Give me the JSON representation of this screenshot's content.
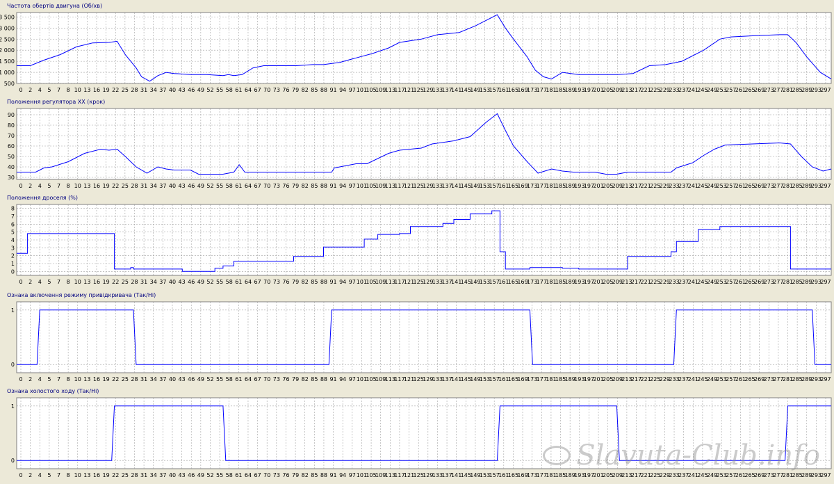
{
  "colors": {
    "background": "#ece9d8",
    "plot_area": "#ffffff",
    "line": "#0000ff",
    "grid": "#a0a0a0",
    "title": "#000080"
  },
  "x_tick_labels": [
    "0",
    "2",
    "4",
    "5",
    "7",
    "8",
    "10",
    "13",
    "16",
    "19",
    "22",
    "25",
    "28",
    "31",
    "34",
    "37",
    "40",
    "43",
    "46",
    "49",
    "52",
    "55",
    "58",
    "61",
    "64",
    "67",
    "70",
    "73",
    "76",
    "79",
    "82",
    "85",
    "88",
    "91",
    "94",
    "97",
    "101",
    "105",
    "109",
    "113",
    "117",
    "121",
    "125",
    "129",
    "133",
    "137",
    "141",
    "145",
    "149",
    "153",
    "157",
    "161",
    "165",
    "169",
    "173",
    "177",
    "181",
    "185",
    "189",
    "193",
    "197",
    "201",
    "205",
    "209",
    "213",
    "217",
    "221",
    "225",
    "229",
    "233",
    "237",
    "241",
    "245",
    "249",
    "253",
    "257",
    "261",
    "265",
    "269",
    "273",
    "277",
    "281",
    "285",
    "289",
    "293",
    "297"
  ],
  "watermark": "Slavuta-Club.info",
  "chart_data": [
    {
      "type": "line",
      "title": "Частота обертів двигуна (Об/хв)",
      "ylim": [
        500,
        3700
      ],
      "yticks": [
        500,
        1000,
        1500,
        2000,
        2500,
        3000,
        3500
      ],
      "ytick_labels": [
        "500",
        "1 000",
        "1 500",
        "2 000",
        "2 500",
        "3 000",
        "3 500"
      ],
      "step": false,
      "points": [
        [
          0,
          1300
        ],
        [
          5,
          1300
        ],
        [
          10,
          1550
        ],
        [
          16,
          1800
        ],
        [
          22,
          2150
        ],
        [
          28,
          2330
        ],
        [
          34,
          2350
        ],
        [
          37,
          2400
        ],
        [
          40,
          1800
        ],
        [
          44,
          1200
        ],
        [
          46,
          800
        ],
        [
          49,
          600
        ],
        [
          52,
          850
        ],
        [
          55,
          1000
        ],
        [
          58,
          950
        ],
        [
          64,
          900
        ],
        [
          70,
          900
        ],
        [
          76,
          850
        ],
        [
          78,
          900
        ],
        [
          80,
          850
        ],
        [
          83,
          900
        ],
        [
          87,
          1200
        ],
        [
          91,
          1300
        ],
        [
          97,
          1300
        ],
        [
          103,
          1300
        ],
        [
          109,
          1350
        ],
        [
          113,
          1350
        ],
        [
          119,
          1450
        ],
        [
          125,
          1650
        ],
        [
          131,
          1850
        ],
        [
          137,
          2100
        ],
        [
          141,
          2350
        ],
        [
          149,
          2500
        ],
        [
          155,
          2700
        ],
        [
          163,
          2800
        ],
        [
          169,
          3100
        ],
        [
          177,
          3600
        ],
        [
          180,
          3000
        ],
        [
          183,
          2500
        ],
        [
          188,
          1700
        ],
        [
          191,
          1100
        ],
        [
          194,
          800
        ],
        [
          197,
          700
        ],
        [
          201,
          1000
        ],
        [
          207,
          900
        ],
        [
          215,
          900
        ],
        [
          221,
          900
        ],
        [
          227,
          950
        ],
        [
          233,
          1300
        ],
        [
          239,
          1350
        ],
        [
          245,
          1500
        ],
        [
          253,
          2000
        ],
        [
          259,
          2500
        ],
        [
          263,
          2600
        ],
        [
          271,
          2650
        ],
        [
          281,
          2700
        ],
        [
          284,
          2700
        ],
        [
          287,
          2350
        ],
        [
          291,
          1700
        ],
        [
          296,
          1000
        ],
        [
          300,
          700
        ]
      ]
    },
    {
      "type": "line",
      "title": "Положення регулятора ХХ (крок)",
      "ylim": [
        28,
        96
      ],
      "yticks": [
        30,
        40,
        50,
        60,
        70,
        80,
        90
      ],
      "ytick_labels": [
        "30",
        "40",
        "50",
        "60",
        "70",
        "80",
        "90"
      ],
      "step": false,
      "points": [
        [
          0,
          35
        ],
        [
          7,
          35
        ],
        [
          10,
          39
        ],
        [
          13,
          40
        ],
        [
          19,
          45
        ],
        [
          25,
          53
        ],
        [
          31,
          57
        ],
        [
          34,
          56
        ],
        [
          37,
          57
        ],
        [
          40,
          50
        ],
        [
          44,
          40
        ],
        [
          48,
          34
        ],
        [
          52,
          40
        ],
        [
          55,
          38
        ],
        [
          58,
          37
        ],
        [
          64,
          37
        ],
        [
          67,
          33
        ],
        [
          73,
          33
        ],
        [
          76,
          33
        ],
        [
          78,
          34
        ],
        [
          80,
          35
        ],
        [
          82,
          42
        ],
        [
          84,
          35
        ],
        [
          90,
          35
        ],
        [
          100,
          35
        ],
        [
          110,
          35
        ],
        [
          116,
          35
        ],
        [
          117,
          39
        ],
        [
          121,
          41
        ],
        [
          125,
          43
        ],
        [
          129,
          43
        ],
        [
          133,
          48
        ],
        [
          137,
          53
        ],
        [
          141,
          56
        ],
        [
          149,
          58
        ],
        [
          153,
          62
        ],
        [
          161,
          65
        ],
        [
          167,
          69
        ],
        [
          173,
          83
        ],
        [
          177,
          91
        ],
        [
          180,
          75
        ],
        [
          183,
          60
        ],
        [
          188,
          45
        ],
        [
          192,
          34
        ],
        [
          197,
          38
        ],
        [
          201,
          36
        ],
        [
          205,
          35
        ],
        [
          213,
          35
        ],
        [
          217,
          33
        ],
        [
          221,
          33
        ],
        [
          225,
          35
        ],
        [
          233,
          35
        ],
        [
          241,
          35
        ],
        [
          243,
          39
        ],
        [
          249,
          44
        ],
        [
          253,
          51
        ],
        [
          257,
          57
        ],
        [
          261,
          61
        ],
        [
          271,
          62
        ],
        [
          281,
          63
        ],
        [
          285,
          62
        ],
        [
          289,
          50
        ],
        [
          293,
          40
        ],
        [
          297,
          36
        ],
        [
          300,
          38
        ]
      ]
    },
    {
      "type": "line",
      "title": "Положення дроселя (%)",
      "ylim": [
        -0.5,
        8.5
      ],
      "yticks": [
        0,
        1,
        2,
        3,
        4,
        5,
        6,
        7,
        8
      ],
      "ytick_labels": [
        "0",
        "1",
        "2",
        "3",
        "4",
        "5",
        "6",
        "7",
        "8"
      ],
      "step": true,
      "points": [
        [
          0,
          2.3
        ],
        [
          3,
          2.3
        ],
        [
          4,
          4.8
        ],
        [
          35,
          4.8
        ],
        [
          36,
          0.3
        ],
        [
          41,
          0.3
        ],
        [
          42,
          0.5
        ],
        [
          43,
          0.3
        ],
        [
          59,
          0.3
        ],
        [
          61,
          0.0
        ],
        [
          71,
          0.0
        ],
        [
          73,
          0.4
        ],
        [
          76,
          0.7
        ],
        [
          80,
          1.3
        ],
        [
          101,
          1.3
        ],
        [
          102,
          1.9
        ],
        [
          109,
          1.9
        ],
        [
          113,
          3.1
        ],
        [
          125,
          3.1
        ],
        [
          128,
          4.1
        ],
        [
          133,
          4.7
        ],
        [
          141,
          4.8
        ],
        [
          145,
          5.7
        ],
        [
          157,
          6.1
        ],
        [
          161,
          6.6
        ],
        [
          167,
          7.3
        ],
        [
          175,
          7.7
        ],
        [
          177,
          7.7
        ],
        [
          178,
          2.5
        ],
        [
          180,
          0.3
        ],
        [
          188,
          0.3
        ],
        [
          189,
          0.5
        ],
        [
          201,
          0.4
        ],
        [
          205,
          0.4
        ],
        [
          207,
          0.3
        ],
        [
          221,
          0.3
        ],
        [
          225,
          1.9
        ],
        [
          239,
          1.9
        ],
        [
          241,
          2.5
        ],
        [
          243,
          3.8
        ],
        [
          251,
          5.3
        ],
        [
          259,
          5.7
        ],
        [
          283,
          5.7
        ],
        [
          285,
          0.3
        ],
        [
          300,
          0.3
        ]
      ]
    },
    {
      "type": "line",
      "title": "Ознака включення режиму привідкривача (Так/Ні)",
      "ylim": [
        -0.15,
        1.15
      ],
      "yticks": [
        0,
        1
      ],
      "ytick_labels": [
        "0",
        "1"
      ],
      "step": false,
      "points": [
        [
          0,
          0
        ],
        [
          7.5,
          0
        ],
        [
          8.5,
          1
        ],
        [
          43,
          1
        ],
        [
          44,
          0
        ],
        [
          115,
          0
        ],
        [
          116,
          1
        ],
        [
          189,
          1
        ],
        [
          190,
          0
        ],
        [
          242,
          0
        ],
        [
          243,
          1
        ],
        [
          293,
          1
        ],
        [
          294,
          0
        ],
        [
          300,
          0
        ]
      ]
    },
    {
      "type": "line",
      "title": "Ознака холостого ходу (Так/Ні)",
      "ylim": [
        -0.15,
        1.15
      ],
      "yticks": [
        0,
        1
      ],
      "ytick_labels": [
        "0",
        "1"
      ],
      "step": false,
      "points": [
        [
          0,
          0
        ],
        [
          35,
          0
        ],
        [
          36,
          1
        ],
        [
          76,
          1
        ],
        [
          77,
          0
        ],
        [
          177,
          0
        ],
        [
          178,
          1
        ],
        [
          221,
          1
        ],
        [
          222,
          0
        ],
        [
          283,
          0
        ],
        [
          284,
          1
        ],
        [
          300,
          1
        ]
      ]
    }
  ]
}
